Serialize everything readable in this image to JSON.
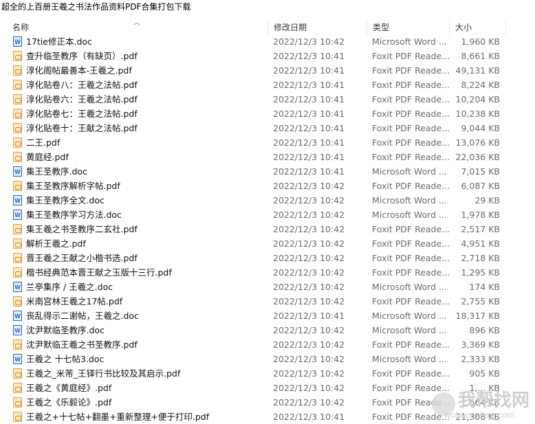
{
  "window": {
    "title": "超全的上百册王羲之书法作品资料PDF合集打包下载"
  },
  "columns": {
    "name": "名称",
    "date": "修改日期",
    "type": "类型",
    "size": "大小"
  },
  "files": [
    {
      "name": "17tie修正本.doc",
      "date": "2022/12/3 10:42",
      "type": "Microsoft Word ...",
      "size": "1,960 KB",
      "kind": "doc"
    },
    {
      "name": "查升临圣教序（有缺页）.pdf",
      "date": "2022/12/3 10:41",
      "type": "Foxit PDF Reade...",
      "size": "8,661 KB",
      "kind": "pdf"
    },
    {
      "name": "淳化阁帖最善本-王羲之.pdf",
      "date": "2022/12/3 10:41",
      "type": "Foxit PDF Reade...",
      "size": "49,131 KB",
      "kind": "pdf"
    },
    {
      "name": "淳化贴卷八：王羲之法帖.pdf",
      "date": "2022/12/3 10:41",
      "type": "Foxit PDF Reade...",
      "size": "8,224 KB",
      "kind": "pdf"
    },
    {
      "name": "淳化贴卷六：王羲之法帖.pdf",
      "date": "2022/12/3 10:41",
      "type": "Foxit PDF Reade...",
      "size": "10,204 KB",
      "kind": "pdf"
    },
    {
      "name": "淳化贴卷七：王羲之法帖.pdf",
      "date": "2022/12/3 10:41",
      "type": "Foxit PDF Reade...",
      "size": "10,238 KB",
      "kind": "pdf"
    },
    {
      "name": "淳化贴卷十：王献之法帖.pdf",
      "date": "2022/12/3 10:41",
      "type": "Foxit PDF Reade...",
      "size": "9,044 KB",
      "kind": "pdf"
    },
    {
      "name": "二王.pdf",
      "date": "2022/12/3 10:41",
      "type": "Foxit PDF Reade...",
      "size": "13,076 KB",
      "kind": "pdf"
    },
    {
      "name": "黄庭经.pdf",
      "date": "2022/12/3 10:41",
      "type": "Foxit PDF Reade...",
      "size": "22,036 KB",
      "kind": "pdf"
    },
    {
      "name": "集王圣教序.doc",
      "date": "2022/12/3 10:41",
      "type": "Microsoft Word ...",
      "size": "7,015 KB",
      "kind": "doc"
    },
    {
      "name": "集王圣教序解析字帖.pdf",
      "date": "2022/12/3 10:42",
      "type": "Foxit PDF Reade...",
      "size": "6,087 KB",
      "kind": "pdf"
    },
    {
      "name": "集王圣教序全文.doc",
      "date": "2022/12/3 10:42",
      "type": "Microsoft Word ...",
      "size": "29 KB",
      "kind": "doc"
    },
    {
      "name": "集王圣教序学习方法.doc",
      "date": "2022/12/3 10:42",
      "type": "Microsoft Word ...",
      "size": "1,978 KB",
      "kind": "doc"
    },
    {
      "name": "集王羲之书圣教序二玄社.pdf",
      "date": "2022/12/3 10:42",
      "type": "Foxit PDF Reade...",
      "size": "2,517 KB",
      "kind": "pdf"
    },
    {
      "name": "解析王羲之.pdf",
      "date": "2022/12/3 10:42",
      "type": "Foxit PDF Reade...",
      "size": "4,951 KB",
      "kind": "pdf"
    },
    {
      "name": "晋王羲之王献之小楷书选.pdf",
      "date": "2022/12/3 10:42",
      "type": "Foxit PDF Reade...",
      "size": "2,718 KB",
      "kind": "pdf"
    },
    {
      "name": "楷书经典范本晋王献之玉版十三行.pdf",
      "date": "2022/12/3 10:42",
      "type": "Foxit PDF Reade...",
      "size": "1,295 KB",
      "kind": "pdf"
    },
    {
      "name": "兰亭集序 / 王羲之.doc",
      "date": "2022/12/3 10:42",
      "type": "Microsoft Word ...",
      "size": "174 KB",
      "kind": "doc"
    },
    {
      "name": "米南宫林王羲之17帖.pdf",
      "date": "2022/12/3 10:42",
      "type": "Foxit PDF Reade...",
      "size": "2,755 KB",
      "kind": "pdf"
    },
    {
      "name": "丧乱得示二谢帖，王羲之.doc",
      "date": "2022/12/3 10:41",
      "type": "Microsoft Word ...",
      "size": "18,317 KB",
      "kind": "doc"
    },
    {
      "name": "沈尹默临圣教序.doc",
      "date": "2022/12/3 10:42",
      "type": "Microsoft Word ...",
      "size": "896 KB",
      "kind": "doc"
    },
    {
      "name": "沈尹默临王羲之书圣教序.pdf",
      "date": "2022/12/3 10:42",
      "type": "Foxit PDF Reade...",
      "size": "3,369 KB",
      "kind": "pdf"
    },
    {
      "name": "王羲之 十七帖3.doc",
      "date": "2022/12/3 10:42",
      "type": "Microsoft Word ...",
      "size": "2,333 KB",
      "kind": "doc"
    },
    {
      "name": "王羲之_米芾_王铎行书比较及其启示.pdf",
      "date": "2022/12/3 10:42",
      "type": "Foxit PDF Reade...",
      "size": "905 KB",
      "kind": "pdf"
    },
    {
      "name": "王羲之《黄庭经》.pdf",
      "date": "2022/12/3 10:42",
      "type": "Foxit PDF Reade...",
      "size": "1,... KB",
      "kind": "pdf"
    },
    {
      "name": "王羲之《乐毅论》.pdf",
      "date": "2022/12/3 10:42",
      "type": "Foxit PDF Reade...",
      "size": "1,664 KB",
      "kind": "pdf"
    },
    {
      "name": "王羲之+十七帖+翻墨+重新整理+便于打印.pdf",
      "date": "2022/12/3 10:41",
      "type": "Foxit PDF Reade...",
      "size": "21,308 KB",
      "kind": "pdf"
    }
  ],
  "watermark": {
    "text": "我帮找网",
    "sub": "wobangzhao.com"
  }
}
